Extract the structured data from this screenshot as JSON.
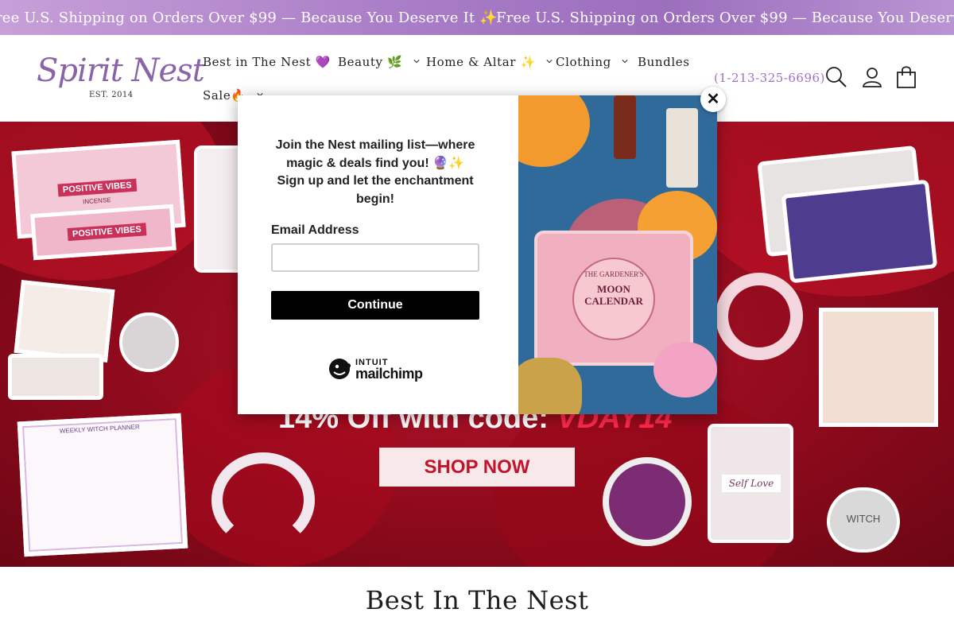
{
  "announcement": {
    "message": "Free U.S. Shipping on Orders Over $99 — Because You Deserve It ✨",
    "message_partial": "ree U.S. Shipping on Orders Over $99 — Because You Deserve It ✨"
  },
  "header": {
    "logo": {
      "name": "Spirit Nest",
      "est": "EST. 2014"
    },
    "nav": [
      {
        "label": "Best in The Nest 💜",
        "has_dropdown": false
      },
      {
        "label": "Beauty 🌿",
        "has_dropdown": true
      },
      {
        "label": "Home & Altar ✨",
        "has_dropdown": true
      },
      {
        "label": "Clothing",
        "has_dropdown": true
      },
      {
        "label": "Bundles",
        "has_dropdown": false
      },
      {
        "label": "Sale🔥",
        "has_dropdown": true
      }
    ],
    "phone": "(1-213-325-6696)",
    "icons": [
      "search-icon",
      "account-icon",
      "cart-icon"
    ]
  },
  "hero": {
    "promo_prefix": "14% Off with code: ",
    "promo_code": "VDAY14",
    "cta": "SHOP NOW",
    "products": {
      "incense_top": "POSITIVE VIBES",
      "incense_top_sub": "INCENSE",
      "incense_bottom": "POSITIVE VIBES",
      "planner_title": "WEEKLY WITCH PLANNER",
      "perfume_label": "Self Love",
      "charm_text": "WITCH"
    }
  },
  "popup": {
    "message_line1": "Join the Nest mailing list—where magic & deals find you! 🔮✨",
    "message_line2": "Sign up and let the enchantment begin!",
    "email_label": "Email Address",
    "email_value": "",
    "continue": "Continue",
    "brand_top": "INTUIT",
    "brand_bottom": "mailchimp",
    "calendar_title": "MOON CALENDAR",
    "calendar_sub": "THE GARDENER'S",
    "close_symbol": "✕"
  },
  "section": {
    "title": "Best In The Nest"
  },
  "colors": {
    "accent_purple": "#8a63a8",
    "phone_purple": "#a06fc6",
    "hero_red": "#b5142a",
    "promo_code": "#ff2a4a",
    "announcement_start": "#c79fd8",
    "announcement_end": "#9c6fbd"
  }
}
